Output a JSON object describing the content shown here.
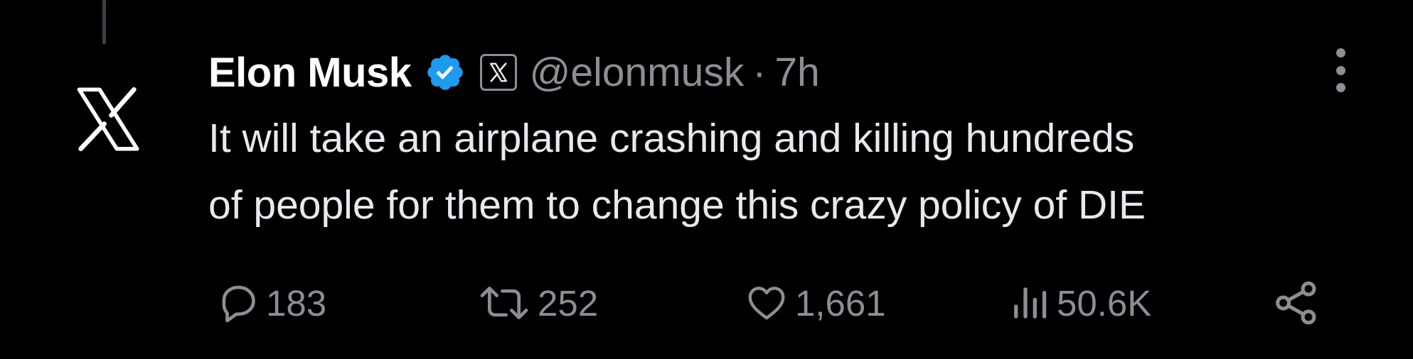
{
  "tweet": {
    "author_name": "Elon Musk",
    "handle": "@elonmusk",
    "separator": "·",
    "time": "7h",
    "text_lines": [
      "It will take an airplane crashing and killing hundreds",
      "of people for them to change this crazy policy of DIE"
    ]
  },
  "actions": {
    "replies": "183",
    "retweets": "252",
    "likes": "1,661",
    "views": "50.6K"
  },
  "icons": {
    "avatar": "x-logo-icon",
    "verified": "verified-badge-icon",
    "affiliate": "x-affiliate-badge-icon",
    "more": "more-vertical-icon",
    "reply": "reply-bubble-icon",
    "retweet": "retweet-icon",
    "like": "heart-icon",
    "views": "views-bar-chart-icon",
    "share": "share-icon"
  },
  "colors": {
    "background": "#000000",
    "text": "#e7e9ea",
    "secondary": "#8b8f93",
    "verified_blue": "#1d9bf0"
  }
}
